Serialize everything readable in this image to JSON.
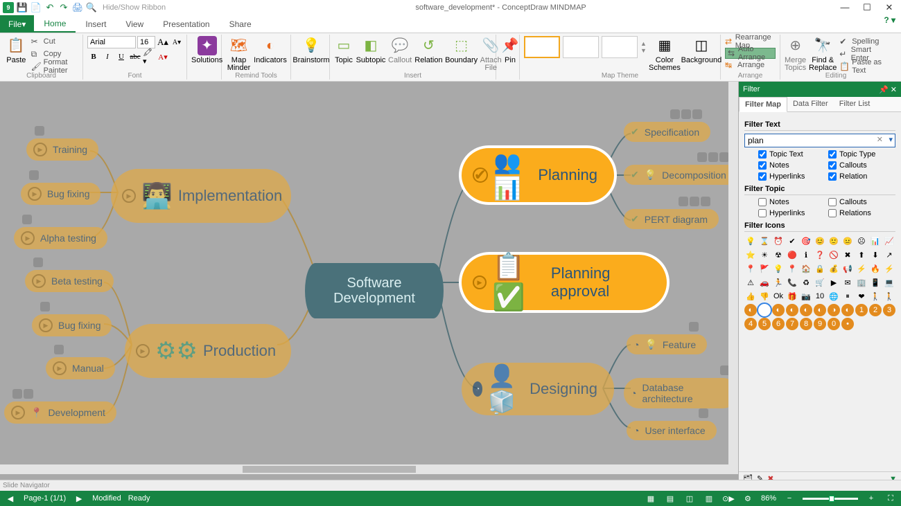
{
  "title": "software_development* - ConceptDraw MINDMAP",
  "qat": {
    "hideShow": "Hide/Show Ribbon"
  },
  "tabs": {
    "file": "File",
    "home": "Home",
    "insert": "Insert",
    "view": "View",
    "presentation": "Presentation",
    "share": "Share"
  },
  "ribbon": {
    "clipboard": {
      "label": "Clipboard",
      "paste": "Paste",
      "cut": "Cut",
      "copy": "Copy",
      "formatPainter": "Format Painter"
    },
    "font": {
      "label": "Font",
      "name": "Arial",
      "size": "16"
    },
    "solutions": {
      "label": "Solutions"
    },
    "remind": {
      "label": "Remind Tools",
      "mapMinder": "Map Minder",
      "indicators": "Indicators"
    },
    "brainstorm": "Brainstorm",
    "insert": {
      "label": "Insert",
      "topic": "Topic",
      "subtopic": "Subtopic",
      "callout": "Callout",
      "relation": "Relation",
      "boundary": "Boundary",
      "attach": "Attach File"
    },
    "pin": "Pin",
    "theme": {
      "label": "Map Theme",
      "schemes": "Color Schemes",
      "background": "Background"
    },
    "arrange": {
      "label": "Arrange",
      "rearrange": "Rearrange Map",
      "auto": "Auto Arrange",
      "arrange": "Arrange"
    },
    "editing": {
      "label": "Editing",
      "mergeTopics": "Merge Topics",
      "findReplace": "Find & Replace",
      "spelling": "Spelling",
      "smartEnter": "Smart Enter",
      "pasteAsText": "Paste as Text"
    }
  },
  "map": {
    "center": "Software Development",
    "left": {
      "implementation": "Implementation",
      "training": "Training",
      "bugfix1": "Bug fixing",
      "alpha": "Alpha testing",
      "production": "Production",
      "beta": "Beta testing",
      "bugfix2": "Bug fixing",
      "manual": "Manual",
      "development": "Development"
    },
    "right": {
      "planning": "Planning",
      "spec": "Specification",
      "decomp": "Decomposition",
      "pert": "PERT diagram",
      "approval": "Planning approval",
      "designing": "Designing",
      "feature": "Feature",
      "db": "Database architecture",
      "ui": "User interface"
    }
  },
  "filter": {
    "title": "Filter",
    "tabs": {
      "map": "Filter Map",
      "data": "Data Filter",
      "list": "Filter List"
    },
    "textLabel": "Filter Text",
    "input": "plan",
    "chk": {
      "topicText": "Topic Text",
      "topicType": "Topic Type",
      "notes": "Notes",
      "callouts": "Callouts",
      "hyperlinks": "Hyperlinks",
      "relation": "Relation"
    },
    "topicLabel": "Filter Topic",
    "tchk": {
      "notes": "Notes",
      "callouts": "Callouts",
      "hyperlinks": "Hyperlinks",
      "relations": "Relations"
    },
    "iconsLabel": "Filter Icons"
  },
  "slideNav": "Slide Navigator",
  "status": {
    "page": "Page-1 (1/1)",
    "modified": "Modified",
    "ready": "Ready",
    "zoom": "86%"
  }
}
